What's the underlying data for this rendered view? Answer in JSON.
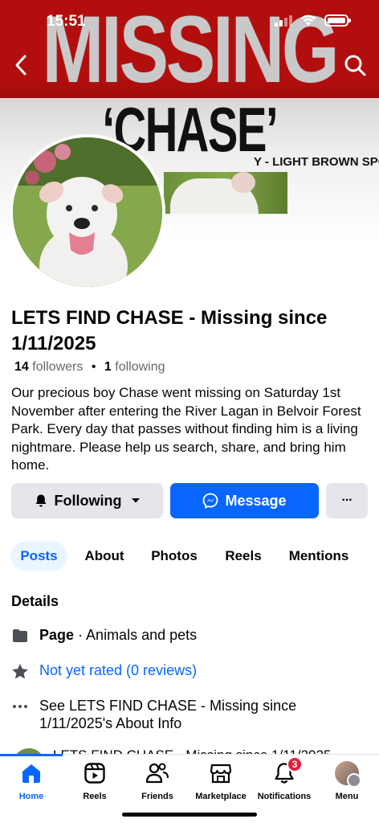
{
  "status_bar": {
    "time": "15:51"
  },
  "cover": {
    "headline": "MISSING",
    "dog_name": "‘CHASE’",
    "description_fragment": "Y - LIGHT BROWN SPOTS ON EARS"
  },
  "profile": {
    "name": "LETS FIND CHASE - Missing since 1/11/2025",
    "followers_count": "14",
    "followers_label": "followers",
    "separator": "•",
    "following_count": "1",
    "following_label": "following",
    "bio": "Our precious boy Chase went missing on Saturday 1st November after entering the River Lagan in Belvoir Forest Park. Every day that passes without finding him is a living nightmare. Please help us search, share, and bring him home."
  },
  "actions": {
    "following_label": "Following",
    "message_label": "Message",
    "more_label": "···"
  },
  "tabs": [
    {
      "label": "Posts",
      "active": true
    },
    {
      "label": "About",
      "active": false
    },
    {
      "label": "Photos",
      "active": false
    },
    {
      "label": "Reels",
      "active": false
    },
    {
      "label": "Mentions",
      "active": false
    }
  ],
  "details": {
    "title": "Details",
    "page_type_label": "Page",
    "page_type_separator": " · ",
    "page_category": "Animals and pets",
    "rating_text": "Not yet rated (0 reviews)",
    "about_link": "See LETS FIND CHASE - Missing since 1/11/2025's About Info"
  },
  "next_post_preview": "LETS FIND CHASE - Missing since 1/11/2025",
  "bottom_nav": {
    "items": [
      {
        "label": "Home",
        "icon": "home-icon",
        "active": true
      },
      {
        "label": "Reels",
        "icon": "reels-icon",
        "active": false
      },
      {
        "label": "Friends",
        "icon": "friends-icon",
        "active": false
      },
      {
        "label": "Marketplace",
        "icon": "marketplace-icon",
        "active": false
      },
      {
        "label": "Notifications",
        "icon": "bell-icon",
        "active": false,
        "badge": "3"
      },
      {
        "label": "Menu",
        "icon": "profile-avatar",
        "active": false
      }
    ]
  },
  "colors": {
    "accent": "#0866ff",
    "cover_red": "#b30e0e",
    "badge_red": "#e41e3f",
    "secondary_text": "#65676b",
    "button_gray": "#e4e6eb"
  }
}
